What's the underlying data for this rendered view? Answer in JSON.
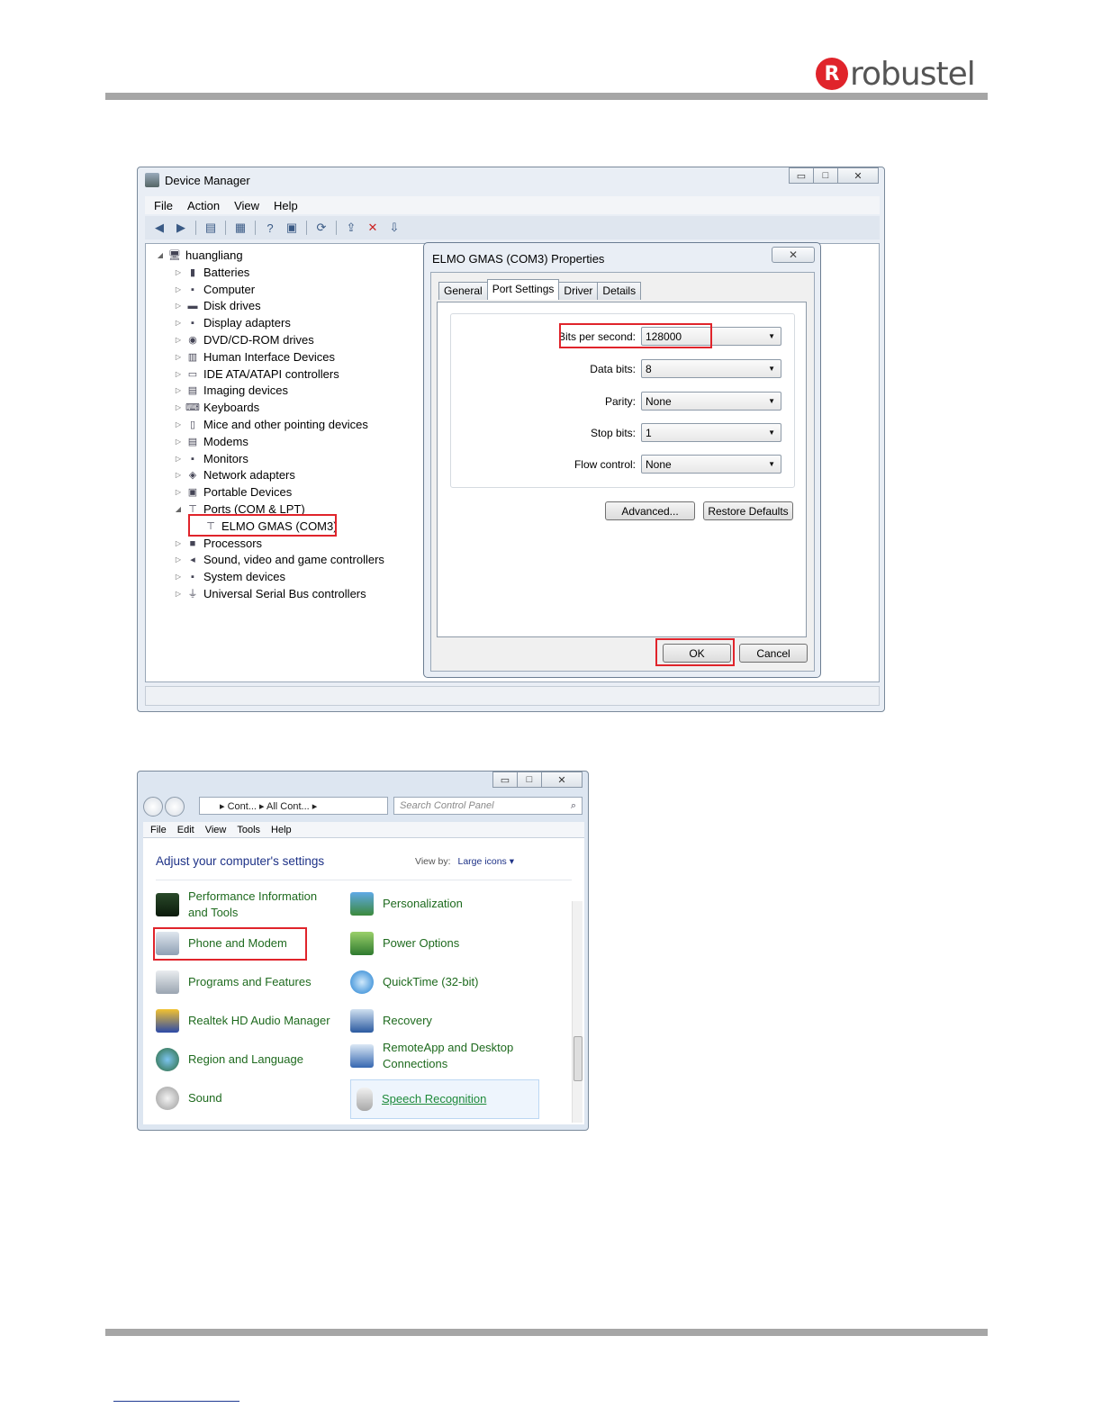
{
  "brand": {
    "logo_letter": "R",
    "logo_text": "robustel",
    "accent": "#e0242b"
  },
  "device_manager": {
    "title": "Device Manager",
    "menu": [
      "File",
      "Action",
      "View",
      "Help"
    ],
    "tree": {
      "root": "huangliang",
      "items": [
        "Batteries",
        "Computer",
        "Disk drives",
        "Display adapters",
        "DVD/CD-ROM drives",
        "Human Interface Devices",
        "IDE ATA/ATAPI controllers",
        "Imaging devices",
        "Keyboards",
        "Mice and other pointing devices",
        "Modems",
        "Monitors",
        "Network adapters",
        "Portable Devices",
        "Ports (COM & LPT)"
      ],
      "port_child": "ELMO GMAS (COM3)",
      "items_after": [
        "Processors",
        "Sound, video and game controllers",
        "System devices",
        "Universal Serial Bus controllers"
      ]
    }
  },
  "properties": {
    "title": "ELMO GMAS (COM3) Properties",
    "close_glyph": "✕",
    "tabs": [
      "General",
      "Port Settings",
      "Driver",
      "Details"
    ],
    "fields": [
      {
        "label": "Bits per second:",
        "value": "128000"
      },
      {
        "label": "Data bits:",
        "value": "8"
      },
      {
        "label": "Parity:",
        "value": "None"
      },
      {
        "label": "Stop bits:",
        "value": "1"
      },
      {
        "label": "Flow control:",
        "value": "None"
      }
    ],
    "advanced_label": "Advanced...",
    "restore_label": "Restore Defaults",
    "ok_label": "OK",
    "cancel_label": "Cancel"
  },
  "control_panel": {
    "path": "▸ Cont... ▸ All Cont... ▸",
    "search_placeholder": "Search Control Panel",
    "menu": [
      "File",
      "Edit",
      "View",
      "Tools",
      "Help"
    ],
    "heading": "Adjust your computer's settings",
    "view_by_label": "View by:",
    "view_by_value": "Large icons ▾",
    "items_left": [
      "Performance Information and Tools",
      "Phone and Modem",
      "Programs and Features",
      "Realtek HD Audio Manager",
      "Region and Language",
      "Sound"
    ],
    "items_right": [
      "Personalization",
      "Power Options",
      "QuickTime (32-bit)",
      "Recovery",
      "RemoteApp and Desktop Connections",
      "Speech Recognition"
    ]
  },
  "colors": {
    "highlight": "#e0242b",
    "link_green": "#1e6a1e",
    "heading_blue": "#1e3287"
  }
}
